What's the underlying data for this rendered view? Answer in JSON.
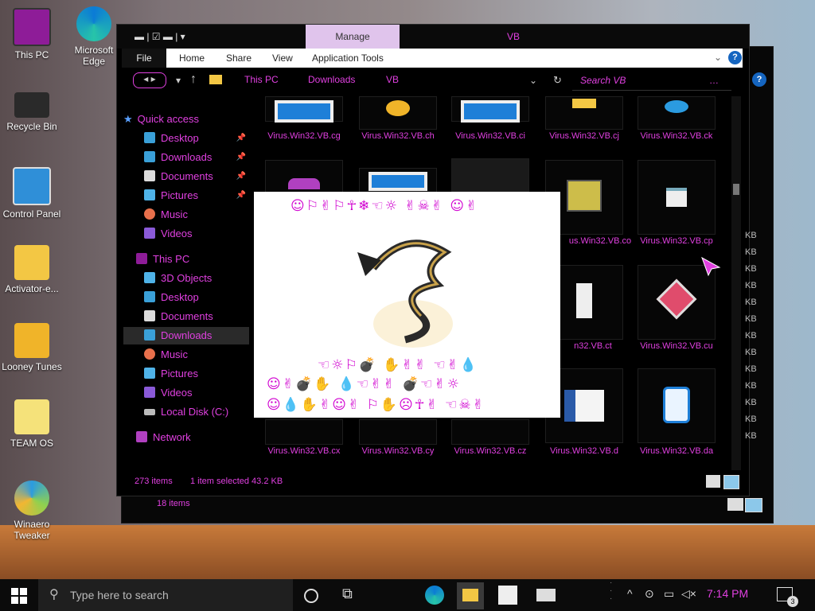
{
  "desktop": {
    "icons": [
      {
        "label": "This PC"
      },
      {
        "label": "Microsoft Edge"
      },
      {
        "label": "Recycle Bin"
      },
      {
        "label": "Control Panel"
      },
      {
        "label": "Activator-e..."
      },
      {
        "label": "Looney Tunes"
      },
      {
        "label": "TEAM OS"
      },
      {
        "label": "Winaero Tweaker"
      }
    ]
  },
  "window": {
    "title": "VB",
    "manage_tab": "Manage",
    "ribbon_tabs": [
      "File",
      "Home",
      "Share",
      "View",
      "Application Tools"
    ],
    "breadcrumb": [
      "This PC",
      "Downloads",
      "VB"
    ],
    "search_placeholder": "Search VB",
    "nav": {
      "quick_access": "Quick access",
      "quick_items": [
        "Desktop",
        "Downloads",
        "Documents",
        "Pictures",
        "Music",
        "Videos"
      ],
      "this_pc": "This PC",
      "pc_items": [
        "3D Objects",
        "Desktop",
        "Documents",
        "Downloads",
        "Music",
        "Pictures",
        "Videos",
        "Local Disk (C:)"
      ],
      "network": "Network"
    },
    "files": [
      {
        "name": "Virus.Win32.VB.cg"
      },
      {
        "name": "Virus.Win32.VB.ch"
      },
      {
        "name": "Virus.Win32.VB.ci"
      },
      {
        "name": "Virus.Win32.VB.cj"
      },
      {
        "name": "Virus.Win32.VB.ck"
      },
      {
        "name": "us.Win32.VB.co"
      },
      {
        "name": "Virus.Win32.VB.cp"
      },
      {
        "name": "n32.VB.ct"
      },
      {
        "name": "Virus.Win32.VB.cu"
      },
      {
        "name": "Virus.Win32.VB.cx"
      },
      {
        "name": "Virus.Win32.VB.cy"
      },
      {
        "name": "Virus.Win32.VB.cz"
      },
      {
        "name": "Virus.Win32.VB.d"
      },
      {
        "name": "Virus.Win32.VB.da"
      }
    ],
    "size_suffix": "KB",
    "status": {
      "items": "273 items",
      "selected": "1 item selected  43.2 KB",
      "back_items": "18 items"
    }
  },
  "popup": {
    "line1": "☺⚐✌⚐☥❄☜☼ ✌☠✌ ☺✌",
    "line2": "☜☼⚐💣 ✋✌✌ ☜✌💧",
    "line3": "☺✌💣✋ 💧☜✌✌ 💣☜✌☼",
    "line4": "☺💧✋✌☺✌ ⚐✋☹☥✌ ☜☠✌"
  },
  "taskbar": {
    "search_placeholder": "Type here to search",
    "clock": "7:14 PM",
    "notifications": "3"
  }
}
